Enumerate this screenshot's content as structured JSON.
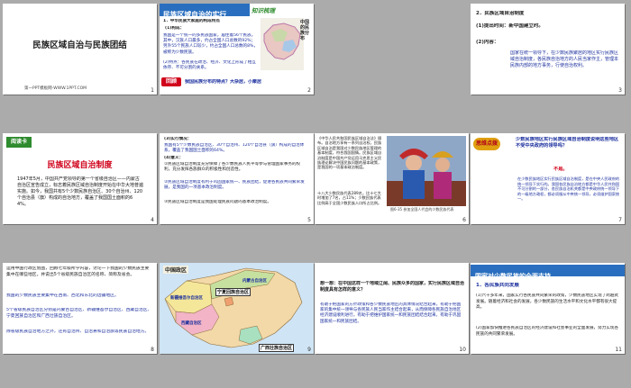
{
  "slides": [
    {
      "num": "1",
      "title": "民族区域自治与民族团结",
      "footer": "第一PPT模板网-WWW.1PPT.COM"
    },
    {
      "num": "2",
      "header": "民族区域自治的实行",
      "subheader": "知识梳理",
      "point1": "1．中华民族大家庭的构成特点",
      "sub1": "(1)构成：",
      "text1": "我国是一个统一的多民族国家，居住着56个民族。其中，汉族人口最多，约占全国人口总数的92%；另外55个民族人口较少，约占全国人口总数的8%，被称为少数民族。",
      "sub2": "(2)特点：各民族在政治、经济、文化上形成了相互依存、不可分割的关系。",
      "map_label": "中国的民族分布",
      "question": "我国民族分布的特点？大杂居，小聚居",
      "stamp": "回顾"
    },
    {
      "num": "3",
      "point": "2．民族区域自治制度",
      "sub1": "(1)提出时间：新中国建立时。",
      "sub2": "(2)内容：",
      "text": "国家在统一领导下，在少数民族聚居的地区实行民族区域自治制度，各民族自治地方的人民当家作主，管理本民族内部的地方事务，行使自治权利。"
    },
    {
      "num": "4",
      "label": "阅读卡",
      "title": "民族区域自治制度",
      "text": "1947年5月，中国共产党领导的第一个省级自治区——内蒙古自治区宣告成立，标志着民族区域自治制度开始在中华大地普遍实施。如今，我国共有5个少数民族自治区、30个自治州、120个自治县（旗）构成的自治地方，覆盖了我国国土面积的64%。"
    },
    {
      "num": "5",
      "s1": "(3)实行情况：",
      "s1_text": "我国有5个少数民族自治区、30个自治州、120个自治县（旗）构成的自治体系，覆盖了我国国土面积的64%。",
      "s2": "(4)意义：",
      "s2_text1": "①民族区域自治制度充分保障了各少数民族人民平等参与管理国家事务的权利，充分发挥各族群众的积极性和创造性。",
      "s2_text2": "②民族区域自治制度有利于巩固国家统一、民族团结，促进各民族共同繁荣发展，是我国的一项基本政治制度。",
      "s2_text3": "③民族区域自治制度是我国处理民族问题的基本政治制度。"
    },
    {
      "num": "6",
      "news": "《中华人民共和国民族区域自治法》颁布。自治地方享有一系列自治权，民族区域自治是我国对少数民族地区管理的基本制度，符合我国国情。民族区域自治制度是中国共产党运用马克思主义民族理论解决中国民族问题的基本政策，是我国的一项基本政治制度。",
      "news2": "十八大少数民族代表289名，比十七大时增加了7名，占11%；少数民族代表比例高于全国少数民族人口所占比例。",
      "caption": "图6-35 参加全国人代会的少数民族代表"
    },
    {
      "num": "7",
      "badge": "思维点拨",
      "question": "少数民族地区实行民族区域自治制度说明这些地区不受中央政府的领导吗？",
      "answer": "不是。",
      "explain": "在少数民族地区实行民族区域自治制度，是在中央人民政府的统一领导下实行的。我国各民族自治地方都是中华人民共和国不可分割的一部分，各民族自治机关都是中央政府统一领导下的一级地方政权，都必须服从中央统一领导，必须维护国家统一。"
    },
    {
      "num": "8",
      "prompt": "运用中国行政区划图，回顾七年级所学内容，讨论一下我国的少数民族主要集中在哪些地区，并说出5个省级民族自治区的名称、简称及省会。",
      "answer1": "我国的少数民族主要集中在西南、西北和东北的边疆地区。",
      "answer2": "5个省级民族自治区分别是内蒙古自治区、新疆维吾尔自治区、西藏自治区、宁夏回族自治区和广西壮族自治区。",
      "answer3": "除省级民族自治地方之外，还有自治州、自治县和自治旗等民族自治地方。"
    },
    {
      "num": "9",
      "map_title": "中国政区",
      "labels": [
        "内蒙古自治区",
        "新疆维吾尔自治区",
        "西藏自治区",
        "宁夏回族自治区",
        "广西壮族自治区"
      ]
    },
    {
      "num": "10",
      "question": "想一想：在中国这样一个地域辽阔、民族众多的国家，实行民族区域自治制度具有怎样的意义？",
      "answer": "有助于把国家的方针政策和各少数民族地区的具体情况结合起来，有助于把国家的集中统一领导与各民族人民当家作主结合起来，从而保障各民族自治地区经济建设顺利进行。有助于把维护国家统一和民族团结结合起来，有助于巩固国家统一和民族团结。"
    },
    {
      "num": "11",
      "header": "国家对少数民族的全面支持",
      "point": "1．各民族共同发展",
      "text1": "(1)六十多年来，国家实行各民族共同繁荣的政策，少数民族地区实现了跨越式发展。随着经济和社会的发展，各少数民族的生活水平和文化水平都有很大提高。",
      "text2": "(2)国家加快推进各民族自治区的经济建设和社会事业的全面发展，努力实现各民族的共同繁荣发展。"
    }
  ]
}
